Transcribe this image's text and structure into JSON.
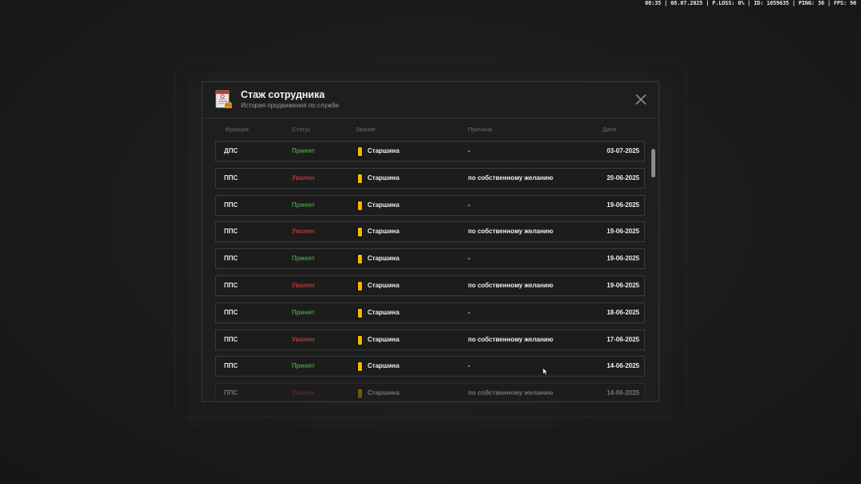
{
  "status_bar": "08:35 | 08.07.2025 | P.LOSS: 0% | ID: 1059635 | PING: 36 | FPS: 90",
  "modal": {
    "title": "Стаж сотрудника",
    "subtitle": "История продвижения по службе",
    "icon": "document-with-briefcase-icon",
    "close_icon": "close-icon"
  },
  "columns": {
    "faction": "Фракция",
    "status": "Статус",
    "rank": "Звание",
    "reason": "Причина",
    "date": "Дата"
  },
  "colors": {
    "accepted": "#3e9b3e",
    "fired": "#b23a3a",
    "rank_badge": "#f5b800"
  },
  "rows": [
    {
      "faction": "ДПС",
      "status": "Принят",
      "status_type": "accepted",
      "rank": "Старшина",
      "reason": "-",
      "date": "03-07-2025"
    },
    {
      "faction": "ППС",
      "status": "Уволен",
      "status_type": "fired",
      "rank": "Старшина",
      "reason": "по собственному желанию",
      "date": "20-06-2025"
    },
    {
      "faction": "ППС",
      "status": "Принят",
      "status_type": "accepted",
      "rank": "Старшина",
      "reason": "-",
      "date": "19-06-2025"
    },
    {
      "faction": "ППС",
      "status": "Уволен",
      "status_type": "fired",
      "rank": "Старшина",
      "reason": "по собственному желанию",
      "date": "19-06-2025"
    },
    {
      "faction": "ППС",
      "status": "Принят",
      "status_type": "accepted",
      "rank": "Старшина",
      "reason": "-",
      "date": "19-06-2025"
    },
    {
      "faction": "ППС",
      "status": "Уволен",
      "status_type": "fired",
      "rank": "Старшина",
      "reason": "по собственному желанию",
      "date": "19-06-2025"
    },
    {
      "faction": "ППС",
      "status": "Принят",
      "status_type": "accepted",
      "rank": "Старшина",
      "reason": "-",
      "date": "18-06-2025"
    },
    {
      "faction": "ППС",
      "status": "Уволен",
      "status_type": "fired",
      "rank": "Старшина",
      "reason": "по собственному желанию",
      "date": "17-06-2025"
    },
    {
      "faction": "ППС",
      "status": "Принят",
      "status_type": "accepted",
      "rank": "Старшина",
      "reason": "-",
      "date": "14-06-2025"
    },
    {
      "faction": "ППС",
      "status": "Уволен",
      "status_type": "fired",
      "rank": "Старшина",
      "reason": "по собственному желанию",
      "date": "14-06-2025"
    }
  ]
}
